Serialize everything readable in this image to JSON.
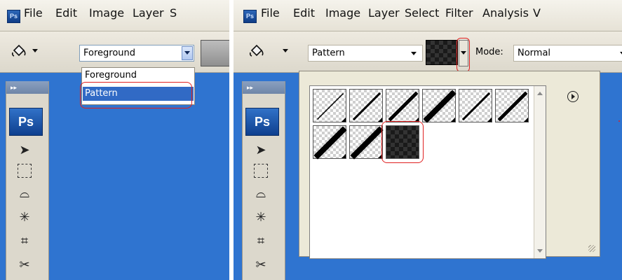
{
  "left": {
    "menubar": {
      "app_badge": "Ps",
      "items": [
        "File",
        "Edit",
        "Image",
        "Layer",
        "S"
      ]
    },
    "options": {
      "fill_source": "Foreground"
    },
    "dropdown": {
      "options": [
        "Foreground",
        "Pattern"
      ],
      "selected": "Pattern"
    },
    "toolbox": {
      "grip": "▸▸",
      "logo": "Ps"
    }
  },
  "right": {
    "menubar": {
      "app_badge": "Ps",
      "items": [
        "File",
        "Edit",
        "Image",
        "Layer",
        "Select",
        "Filter",
        "Analysis",
        "V"
      ]
    },
    "options": {
      "fill_source": "Pattern",
      "mode_label": "Mode:",
      "mode_value": "Normal"
    },
    "toolbox": {
      "grip": "▸▸",
      "logo": "Ps"
    },
    "pattern_picker": {
      "swatches": [
        "diagonal-thin",
        "diagonal-medium",
        "diagonal-thick",
        "diagonal-heavy",
        "diagonal-medium",
        "diagonal-thick",
        "diagonal-heavy",
        "diagonal-heavy",
        "dark-noise"
      ],
      "selected": "dark-noise"
    }
  },
  "colors": {
    "canvas": "#2f74d0",
    "highlight": "#e02020",
    "selection": "#316ac5"
  },
  "icons": [
    "paint-bucket-icon",
    "move-tool-icon",
    "marquee-tool-icon",
    "lasso-tool-icon",
    "magic-wand-icon",
    "crop-tool-icon",
    "slice-tool-icon",
    "picker-menu-icon"
  ]
}
